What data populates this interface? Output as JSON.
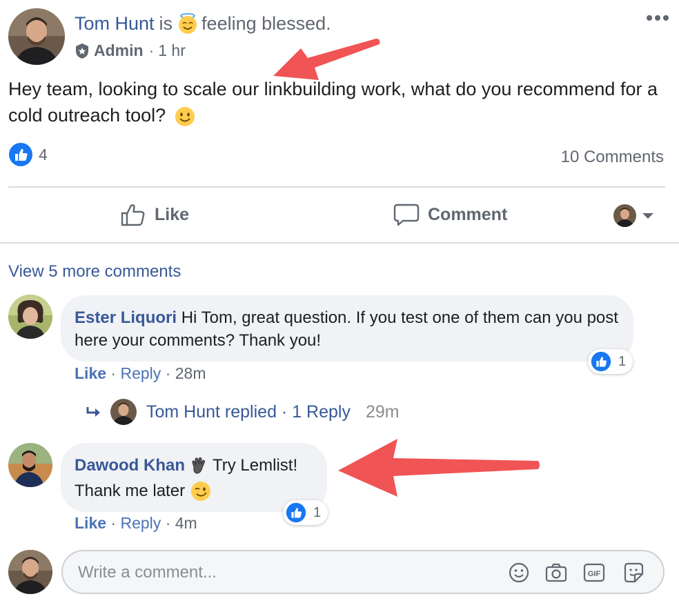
{
  "post": {
    "author": "Tom Hunt",
    "is_text": "is",
    "feeling": "feeling blessed.",
    "role": "Admin",
    "separator": "·",
    "time": "1 hr",
    "text": "Hey team, looking to scale our linkbuilding work, what do you recommend for a cold outreach tool?",
    "reaction_count": "4",
    "comments_count": "10 Comments"
  },
  "actions": {
    "like_label": "Like",
    "comment_label": "Comment"
  },
  "view_more": "View 5 more comments",
  "comments": [
    {
      "author": "Ester Liquori",
      "text": "Hi Tom, great question. If you test one of them can you post here your comments? Thank you!",
      "reaction_count": "1",
      "like_label": "Like",
      "reply_label": "Reply",
      "time": "28m",
      "reply_summary": {
        "text": "Tom Hunt replied · 1 Reply",
        "time": "29m"
      }
    },
    {
      "author": "Dawood Khan",
      "text": "Try Lemlist!",
      "text2": "Thank me later",
      "reaction_count": "1",
      "like_label": "Like",
      "reply_label": "Reply",
      "time": "4m"
    }
  ],
  "composer": {
    "placeholder": "Write a comment..."
  },
  "colors": {
    "link_blue": "#385898",
    "like_blue": "#1877f2",
    "annotation_arrow": "#f05454"
  },
  "icons": [
    "more-options-icon",
    "admin-shield-icon",
    "thumbs-up-icon",
    "comment-bubble-icon",
    "chevron-down-icon",
    "reply-arrow-icon",
    "smiley-icon",
    "camera-icon",
    "gif-icon",
    "sticker-icon"
  ]
}
